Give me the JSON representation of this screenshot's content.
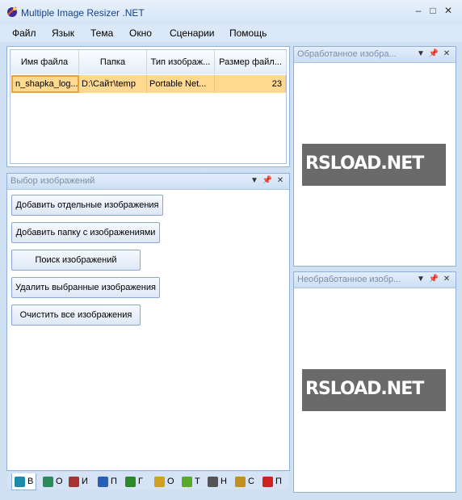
{
  "window": {
    "title": "Multiple Image Resizer .NET",
    "minimize": "–",
    "maximize": "□",
    "close": "✕"
  },
  "menu": [
    "Файл",
    "Язык",
    "Тема",
    "Окно",
    "Сценарии",
    "Помощь"
  ],
  "grid": {
    "columns": [
      "Имя файла",
      "Папка",
      "Тип изображ...",
      "Размер файл..."
    ],
    "rows": [
      [
        "n_shapka_log...",
        "D:\\Сайт\\temp",
        "Portable Net...",
        "23"
      ]
    ]
  },
  "select_panel": {
    "title": "Выбор изображений",
    "buttons": [
      "Добавить отдельные изображения",
      "Добавить папку с изображениями",
      "Поиск изображений",
      "Удалить выбранные изображения",
      "Очистить все изображения"
    ]
  },
  "processed_panel": {
    "title": "Обработанное изобра...",
    "logo": "RSLOAD.NET"
  },
  "unprocessed_panel": {
    "title": "Необработанное изобр...",
    "logo": "RSLOAD.NET"
  },
  "tabs": [
    {
      "label": "В",
      "color": "#1e8ba8",
      "icon": "image-icon"
    },
    {
      "label": "О",
      "color": "#2c8b5a",
      "icon": "checkbox-icon"
    },
    {
      "label": "И",
      "color": "#a83232",
      "icon": "resize-icon"
    },
    {
      "label": "П",
      "color": "#2a5fb8",
      "icon": "rotate-icon"
    },
    {
      "label": "Г",
      "color": "#2a8a2a",
      "icon": "border-icon"
    },
    {
      "label": "О",
      "color": "#d0a020",
      "icon": "filter-icon"
    },
    {
      "label": "Т",
      "color": "#5aa82a",
      "icon": "text-icon"
    },
    {
      "label": "Н",
      "color": "#555555",
      "icon": "settings-icon"
    },
    {
      "label": "С",
      "color": "#c09020",
      "icon": "save-icon"
    },
    {
      "label": "П",
      "color": "#d02020",
      "icon": "play-icon"
    }
  ]
}
